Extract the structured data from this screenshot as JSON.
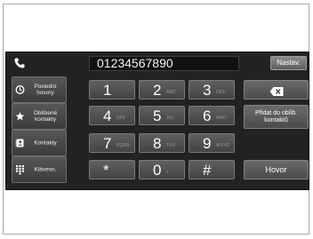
{
  "header": {
    "phone_icon": "phone-icon",
    "number": "01234567890",
    "settings_label": "Nastav."
  },
  "sidebar": {
    "items": [
      {
        "label": "Poslední hovory",
        "icon": "clock-icon"
      },
      {
        "label": "Oblíbené kontakty",
        "icon": "star-icon"
      },
      {
        "label": "Kontakty",
        "icon": "contacts-book-icon"
      },
      {
        "label": "Klávesn.",
        "icon": "keypad-icon"
      }
    ]
  },
  "keypad": {
    "keys": [
      {
        "digit": "1",
        "letters": ""
      },
      {
        "digit": "2",
        "letters": "ABC"
      },
      {
        "digit": "3",
        "letters": "DEF"
      },
      {
        "digit": "4",
        "letters": "GHI"
      },
      {
        "digit": "5",
        "letters": "JKL"
      },
      {
        "digit": "6",
        "letters": "MNO"
      },
      {
        "digit": "7",
        "letters": "PQRS"
      },
      {
        "digit": "8",
        "letters": "TUV"
      },
      {
        "digit": "9",
        "letters": "WXYZ"
      },
      {
        "digit": "*",
        "letters": ""
      },
      {
        "digit": "0",
        "letters": "+"
      },
      {
        "digit": "#",
        "letters": ""
      }
    ]
  },
  "actions": {
    "backspace_icon": "backspace-icon",
    "add_favorite_label": "Přidat do oblíb. kontaktů",
    "call_label": "Hovor"
  },
  "colors": {
    "screen_bg": "#222224",
    "button_bg": "#555555",
    "text": "#ffffff"
  }
}
